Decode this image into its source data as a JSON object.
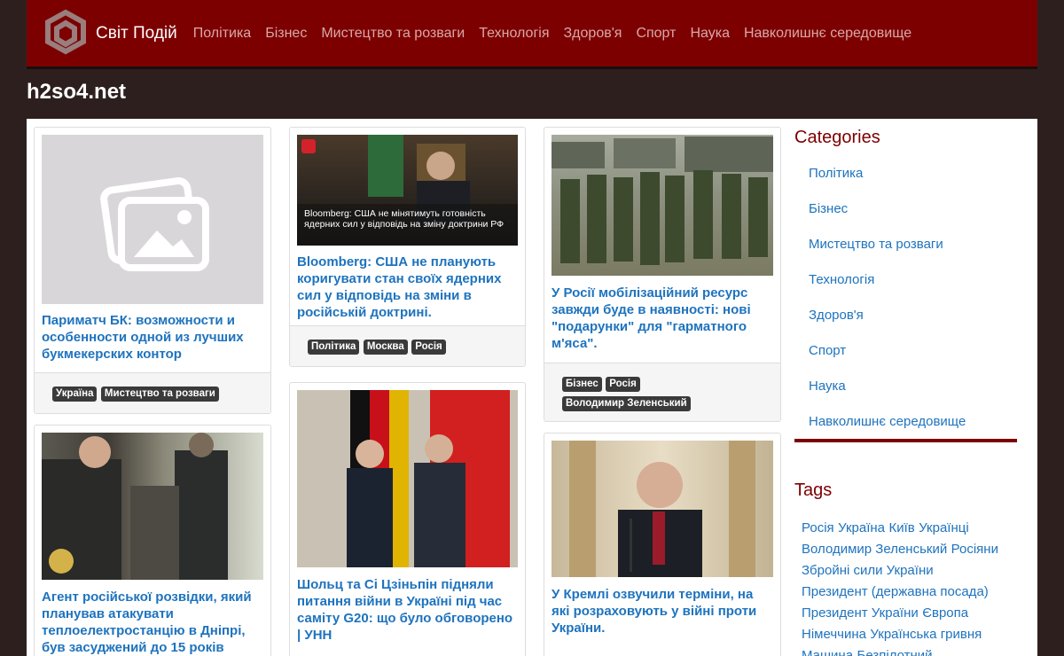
{
  "header": {
    "logo_text": "Світ Подій",
    "nav": [
      "Політика",
      "Бізнес",
      "Мистецтво та розваги",
      "Технологія",
      "Здоров'я",
      "Спорт",
      "Наука",
      "Навколишнє середовище"
    ]
  },
  "site_title": "h2so4.net",
  "articles": [
    {
      "title": "Париматч БК: возможности и особенности одной из лучших букмекерских контор",
      "tags": [
        "Україна",
        "Мистецтво та розваги"
      ]
    },
    {
      "title": "Агент російської розвідки, який планував атакувати теплоелектростанцію в Дніпрі, був засуджений до 15 років",
      "tags": []
    },
    {
      "image_caption": "Bloomberg: США не мінятимуть готовність ядерних сил у відповідь на зміну доктрини РФ",
      "title": "Bloomberg: США не планують коригувати стан своїх ядерних сил у відповідь на зміни в російській доктрині.",
      "tags": [
        "Політика",
        "Москва",
        "Росія"
      ]
    },
    {
      "title": "Шольц та Сі Цзіньпін підняли питання війни в Україні під час саміту G20: що було обговорено | УНН",
      "tags": []
    },
    {
      "title": "У Росії мобілізаційний ресурс завжди буде в наявності: нові \"подарунки\" для \"гарматного м'яса\".",
      "tags": [
        "Бізнес",
        "Росія",
        "Володимир Зеленський"
      ]
    },
    {
      "title": "У Кремлі озвучили терміни, на які розраховують у війні проти України.",
      "tags": []
    }
  ],
  "sidebar": {
    "categories_heading": "Categories",
    "categories": [
      "Політика",
      "Бізнес",
      "Мистецтво та розваги",
      "Технологія",
      "Здоров'я",
      "Спорт",
      "Наука",
      "Навколишнє середовище"
    ],
    "tags_heading": "Tags",
    "tags": [
      "Росія",
      "Україна",
      "Київ",
      "Українці",
      "Володимир Зеленський",
      "Росіяни",
      "Збройні сили України",
      "Президент (державна посада)",
      "Президент України",
      "Європа",
      "Німеччина",
      "Українська гривня",
      "Машина",
      "Безпілотний"
    ]
  },
  "colors": {
    "brand": "#7d0000",
    "link": "#1e73be",
    "page_bg": "#2e1f1f"
  }
}
